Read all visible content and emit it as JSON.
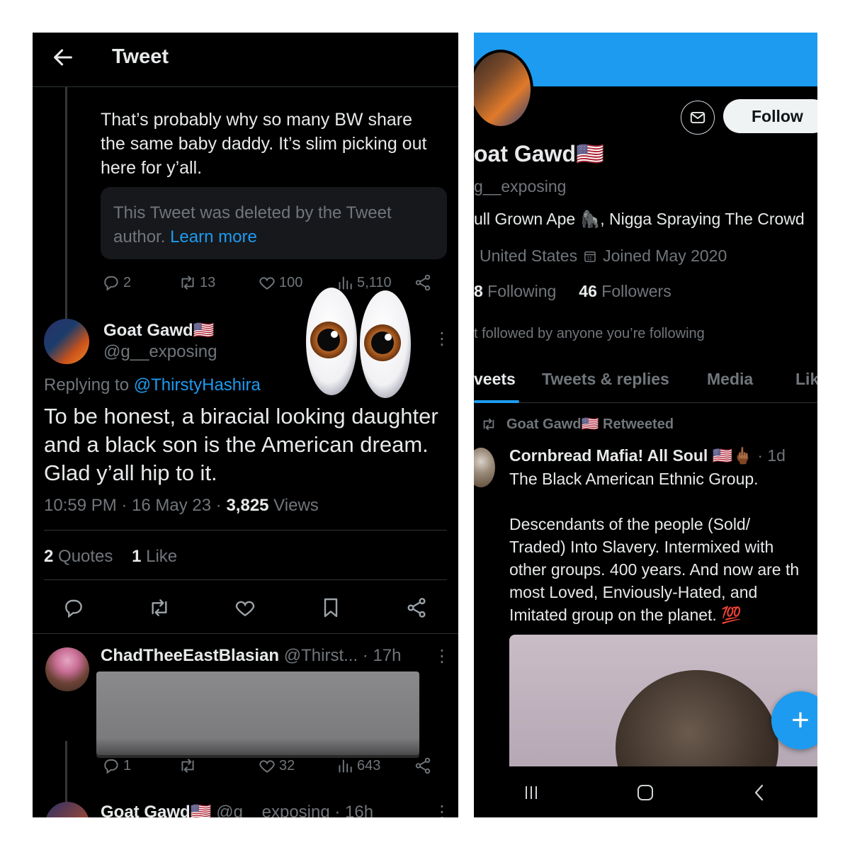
{
  "left": {
    "header": {
      "title": "Tweet"
    },
    "parent_tweet": {
      "text": "That’s probably why so many BW share the same baby daddy. It’s slim picking out here for y’all.",
      "deleted_notice": "This Tweet was deleted by the Tweet author.",
      "learn_more": "Learn more",
      "stats": {
        "replies": "2",
        "retweets": "13",
        "likes": "100",
        "views": "5,110"
      }
    },
    "main_tweet": {
      "name": "Goat Gawd🇺🇸",
      "handle": "@g__exposing",
      "replying_prefix": "Replying to",
      "replying_handle": "@ThirstyHashira",
      "text": "To be honest, a biracial looking daughter and a black son is the American dream. Glad y’all hip to it.",
      "time": "10:59 PM · 16 May 23 · ",
      "views_count": "3,825",
      "views_label": " Views",
      "quotes_count": "2",
      "quotes_label": " Quotes",
      "likes_count": "1",
      "likes_label": " Like"
    },
    "reply1": {
      "name": "ChadTheeEastBlasian",
      "handle_time": " @Thirst... · 17h",
      "stats": {
        "replies": "1",
        "likes": "32",
        "views": "643"
      }
    },
    "reply2": {
      "name": "Goat Gawd🇺🇸",
      "handle_time": " @g__exposing · 16h"
    },
    "more_glyph": "⋮",
    "emoji": "eyes-emoji"
  },
  "right": {
    "follow_label": "Follow",
    "name": "oat Gawd🇺🇸",
    "handle": "g__exposing",
    "bio": "ull Grown Ape 🦍, Nigga Spraying The Crowd",
    "location": "United States",
    "joined": "Joined May 2020",
    "following_count": "8",
    "following_label": " Following",
    "followers_count": "46",
    "followers_label": " Followers",
    "not_followed": "t followed by anyone you’re following",
    "tabs": [
      "veets",
      "Tweets & replies",
      "Media",
      "Lik"
    ],
    "retweeted_label": "Goat Gawd🇺🇸 Retweeted",
    "rt_tweet": {
      "name": "Cornbread Mafia! All Soul 🇺🇸🖕🏾",
      "time": " · 1d",
      "text": "The Black American Ethnic Group.\n\nDescendants of the people (Sold/\nTraded) Into Slavery. Intermixed with\nother groups. 400 years. And now are th\nmost Loved, Enviously-Hated, and\nImitated group on the planet. 💯"
    },
    "fab_glyph": "+"
  },
  "colors": {
    "accent": "#1d9bf0",
    "background": "#000000",
    "muted": "#71767b",
    "text": "#e7e9ea"
  }
}
